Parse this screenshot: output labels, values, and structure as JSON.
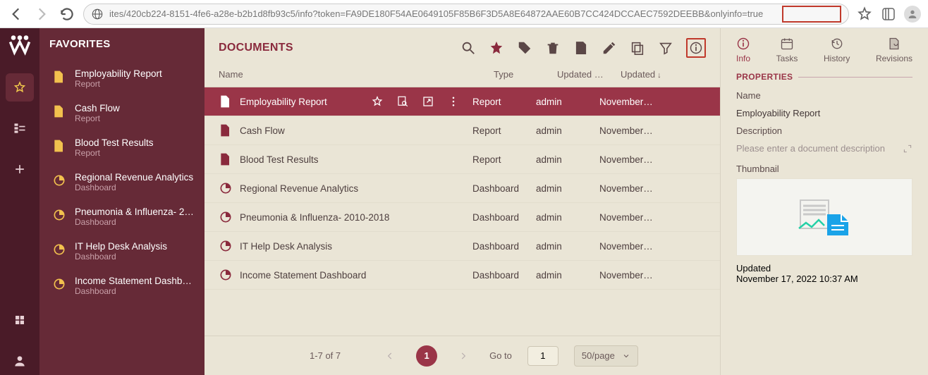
{
  "browser": {
    "url": "ites/420cb224-8151-4fe6-a28e-b2b1d8fb93c5/info?token=FA9DE180F54AE0649105F85B6F3D5A8E64872AAE60B7CC424DCCAEC7592DEEBB&onlyinfo=true"
  },
  "sidebar": {
    "title": "FAVORITES",
    "items": [
      {
        "label": "Employability Report",
        "sub": "Report",
        "icon": "doc"
      },
      {
        "label": "Cash Flow",
        "sub": "Report",
        "icon": "doc"
      },
      {
        "label": "Blood Test Results",
        "sub": "Report",
        "icon": "doc"
      },
      {
        "label": "Regional Revenue Analytics",
        "sub": "Dashboard",
        "icon": "dash"
      },
      {
        "label": "Pneumonia & Influenza- 20…",
        "sub": "Dashboard",
        "icon": "dash"
      },
      {
        "label": "IT Help Desk Analysis",
        "sub": "Dashboard",
        "icon": "dash"
      },
      {
        "label": "Income Statement Dashbo…",
        "sub": "Dashboard",
        "icon": "dash"
      }
    ]
  },
  "main": {
    "title": "DOCUMENTS",
    "columns": {
      "name": "Name",
      "type": "Type",
      "updated_by": "Updated …",
      "updated": "Updated"
    },
    "rows": [
      {
        "name": "Employability Report",
        "type": "Report",
        "by": "admin",
        "date": "November…",
        "icon": "doc",
        "selected": true
      },
      {
        "name": "Cash Flow",
        "type": "Report",
        "by": "admin",
        "date": "November…",
        "icon": "doc"
      },
      {
        "name": "Blood Test Results",
        "type": "Report",
        "by": "admin",
        "date": "November…",
        "icon": "doc"
      },
      {
        "name": "Regional Revenue Analytics",
        "type": "Dashboard",
        "by": "admin",
        "date": "November…",
        "icon": "dash"
      },
      {
        "name": "Pneumonia & Influenza- 2010-2018",
        "type": "Dashboard",
        "by": "admin",
        "date": "November…",
        "icon": "dash"
      },
      {
        "name": "IT Help Desk Analysis",
        "type": "Dashboard",
        "by": "admin",
        "date": "November…",
        "icon": "dash"
      },
      {
        "name": "Income Statement Dashboard",
        "type": "Dashboard",
        "by": "admin",
        "date": "November…",
        "icon": "dash"
      }
    ],
    "footer": {
      "range": "1-7 of 7",
      "page": "1",
      "goto_label": "Go to",
      "goto_value": "1",
      "page_size": "50/page"
    }
  },
  "info": {
    "tabs": {
      "info": "Info",
      "tasks": "Tasks",
      "history": "History",
      "revisions": "Revisions"
    },
    "properties_header": "PROPERTIES",
    "name_label": "Name",
    "name_value": "Employability Report",
    "desc_label": "Description",
    "desc_placeholder": "Please enter a document description",
    "thumb_label": "Thumbnail",
    "updated_label": "Updated",
    "updated_value": "November 17, 2022 10:37 AM"
  }
}
